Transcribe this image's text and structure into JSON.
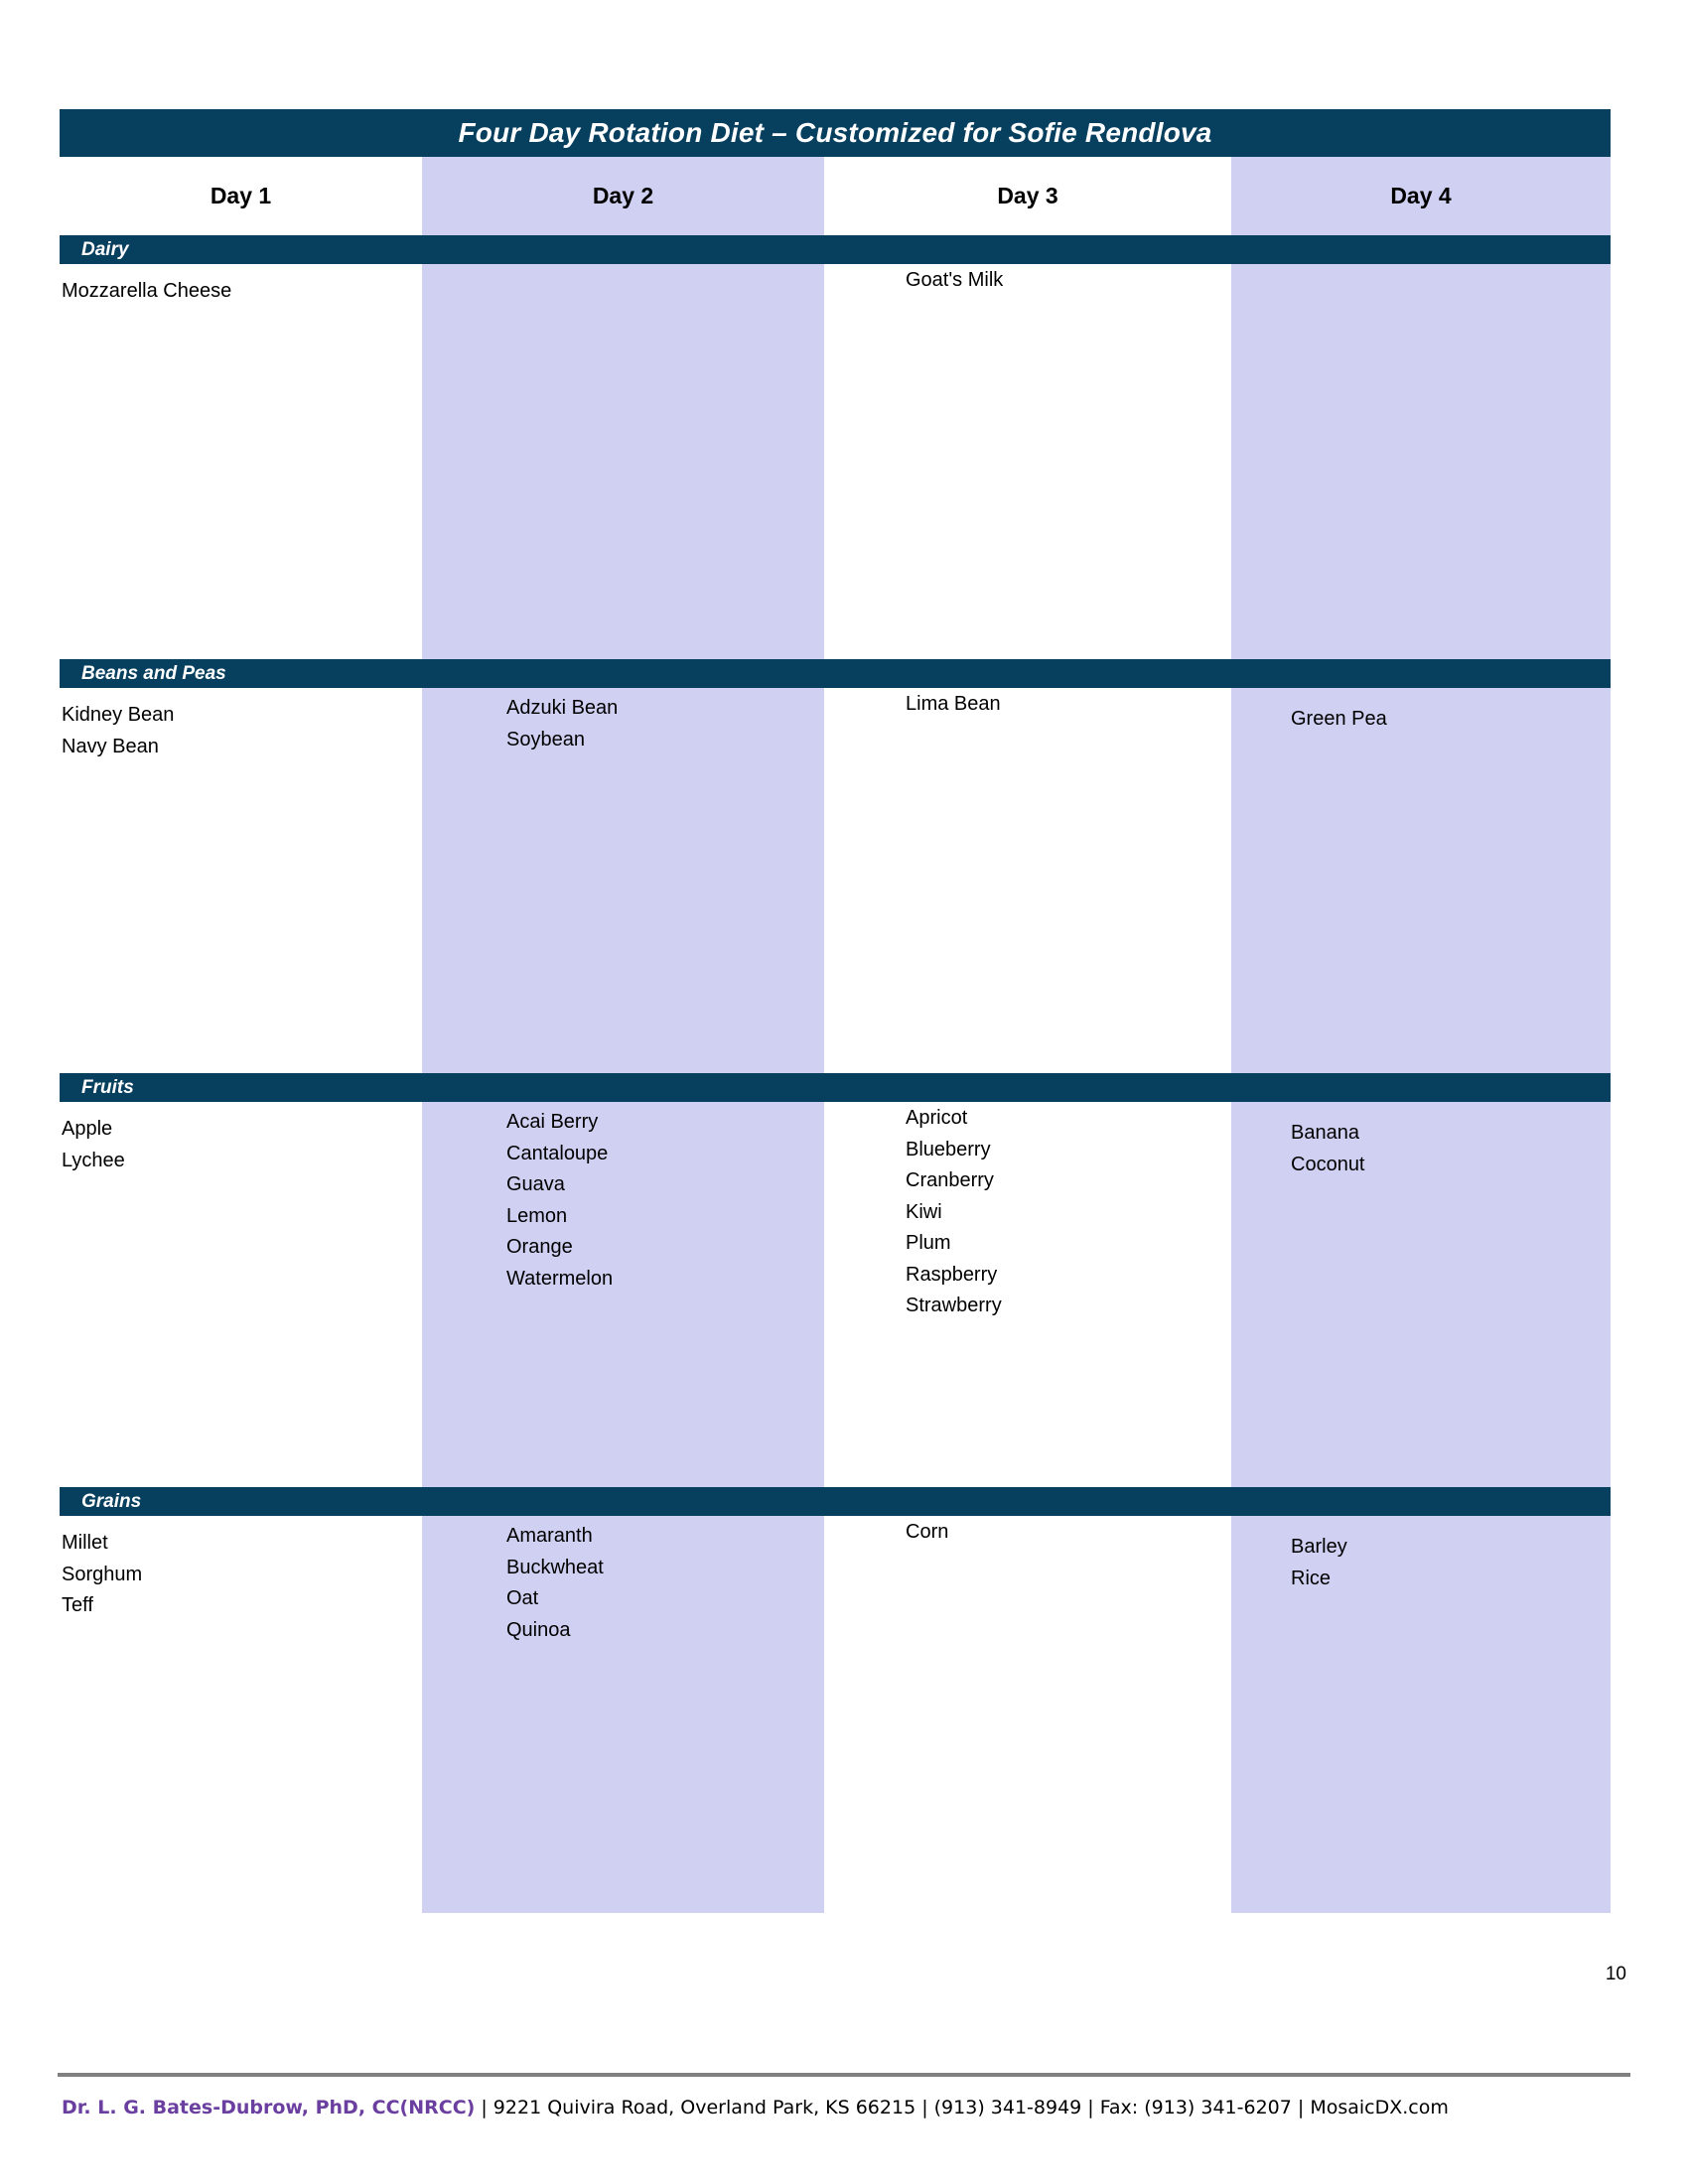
{
  "document": {
    "title": "Four Day Rotation Diet – Customized for Sofie Rendlova",
    "page_number": "10"
  },
  "table": {
    "columns": [
      {
        "label": "Day 1"
      },
      {
        "label": "Day 2"
      },
      {
        "label": "Day 3"
      },
      {
        "label": "Day 4"
      }
    ],
    "sections": [
      {
        "name": "Dairy",
        "day1": [
          "Mozzarella Cheese"
        ],
        "day2": [],
        "day3": [
          "Goat's Milk"
        ],
        "day4": []
      },
      {
        "name": "Beans and Peas",
        "day1": [
          "Kidney Bean",
          "Navy Bean"
        ],
        "day2": [
          "Adzuki Bean",
          "Soybean"
        ],
        "day3": [
          "Lima Bean"
        ],
        "day4": [
          "Green Pea"
        ]
      },
      {
        "name": "Fruits",
        "day1": [
          "Apple",
          "Lychee"
        ],
        "day2": [
          "Acai Berry",
          "Cantaloupe",
          "Guava",
          "Lemon",
          "Orange",
          "Watermelon"
        ],
        "day3": [
          "Apricot",
          "Blueberry",
          "Cranberry",
          "Kiwi",
          "Plum",
          "Raspberry",
          "Strawberry"
        ],
        "day4": [
          "Banana",
          "Coconut"
        ]
      },
      {
        "name": "Grains",
        "day1": [
          "Millet",
          "Sorghum",
          "Teff"
        ],
        "day2": [
          "Amaranth",
          "Buckwheat",
          "Oat",
          "Quinoa"
        ],
        "day3": [
          "Corn"
        ],
        "day4": [
          "Barley",
          "Rice"
        ]
      }
    ]
  },
  "footer": {
    "doctor": "Dr. L. G. Bates-Dubrow, PhD, CC(NRCC)",
    "rest": " | 9221 Quivira Road, Overland Park, KS 66215  |  (913) 341-8949  |  Fax: (913) 341-6207 | MosaicDX.com"
  },
  "colors": {
    "header_navy": "#073F5E",
    "band_lavender": "#CFD0F2",
    "footer_purple": "#6B3FA0",
    "footer_rule_gray": "#808080"
  }
}
